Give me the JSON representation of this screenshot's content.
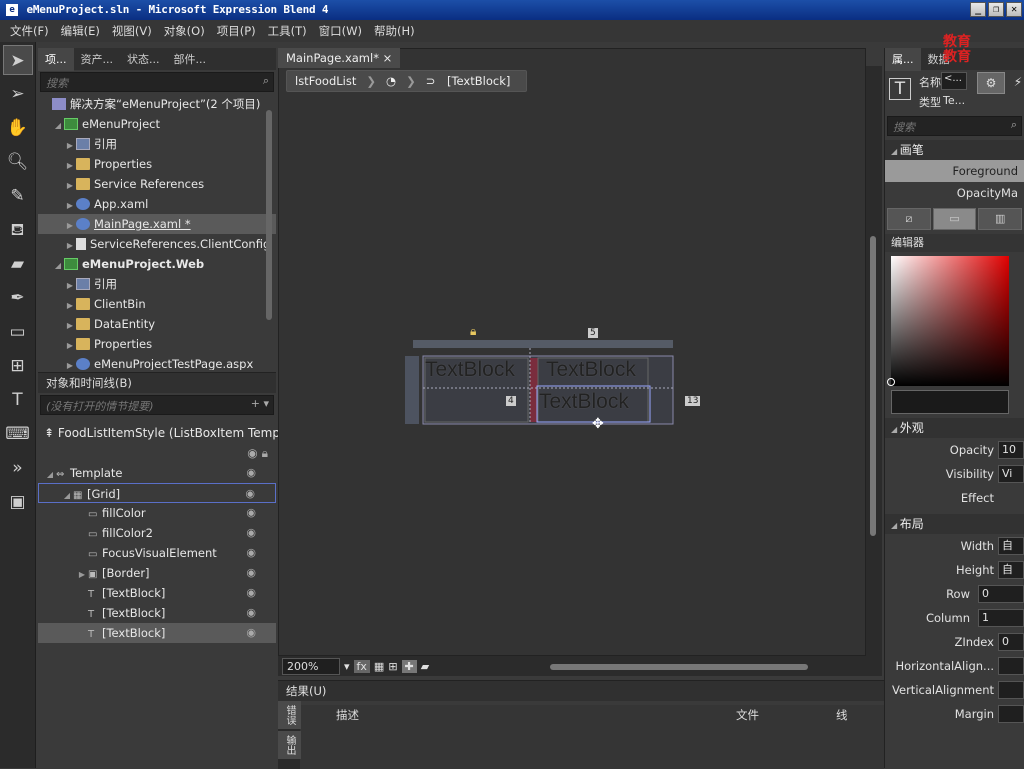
{
  "window": {
    "title": "eMenuProject.sln - Microsoft Expression Blend 4",
    "icon_name": "blend-app-icon"
  },
  "menu": [
    "文件(F)",
    "编辑(E)",
    "视图(V)",
    "对象(O)",
    "项目(P)",
    "工具(T)",
    "窗口(W)",
    "帮助(H)"
  ],
  "toolbox": [
    "selection-icon",
    "direct-selection-icon",
    "pan-icon",
    "zoom-icon",
    "eyedropper-icon",
    "paint-bucket-icon",
    "gradient-icon",
    "pen-icon",
    "rectangle-icon",
    "grid-layout-icon",
    "text-icon",
    "assets-icon",
    "expand-icon",
    "image-icon"
  ],
  "left_tabs": [
    "项...",
    "资产...",
    "状态...",
    "部件..."
  ],
  "project_search_placeholder": "搜索",
  "project_tree": [
    {
      "label": "解决方案“eMenuProject”(2 个项目)",
      "indent": 0,
      "icon": "sol"
    },
    {
      "label": "eMenuProject",
      "indent": 1,
      "icon": "proj",
      "bold": false
    },
    {
      "label": "引用",
      "indent": 2,
      "icon": "ref"
    },
    {
      "label": "Properties",
      "indent": 2,
      "icon": "folder"
    },
    {
      "label": "Service References",
      "indent": 2,
      "icon": "folder"
    },
    {
      "label": "App.xaml",
      "indent": 2,
      "icon": "file"
    },
    {
      "label": "MainPage.xaml *",
      "indent": 2,
      "icon": "file",
      "selected": true
    },
    {
      "label": "ServiceReferences.ClientConfig",
      "indent": 2,
      "icon": "doc"
    },
    {
      "label": "eMenuProject.Web",
      "indent": 1,
      "icon": "proj",
      "bold": true
    },
    {
      "label": "引用",
      "indent": 2,
      "icon": "ref"
    },
    {
      "label": "ClientBin",
      "indent": 2,
      "icon": "folder"
    },
    {
      "label": "DataEntity",
      "indent": 2,
      "icon": "folder"
    },
    {
      "label": "Properties",
      "indent": 2,
      "icon": "folder"
    },
    {
      "label": "eMenuProjectTestPage.aspx",
      "indent": 2,
      "icon": "file"
    }
  ],
  "objects": {
    "header": "对象和时间线(B)",
    "search_placeholder": "(没有打开的情节提要)",
    "scope": "FoodListItemStyle (ListBoxItem Templat...",
    "tree": [
      {
        "label": "Template",
        "indent": 0,
        "icon": "⇔"
      },
      {
        "label": "[Grid]",
        "indent": 1,
        "icon": "▦",
        "selected": true
      },
      {
        "label": "fillColor",
        "indent": 2,
        "icon": "▭"
      },
      {
        "label": "fillColor2",
        "indent": 2,
        "icon": "▭"
      },
      {
        "label": "FocusVisualElement",
        "indent": 2,
        "icon": "▭"
      },
      {
        "label": "[Border]",
        "indent": 2,
        "icon": "▣"
      },
      {
        "label": "[TextBlock]",
        "indent": 2,
        "icon": "T"
      },
      {
        "label": "[TextBlock]",
        "indent": 2,
        "icon": "T"
      },
      {
        "label": "[TextBlock]",
        "indent": 2,
        "icon": "T",
        "active": true
      }
    ]
  },
  "doc_tab": "MainPage.xaml*",
  "breadcrumb": [
    "lstFoodList",
    "[TextBlock]"
  ],
  "canvas": {
    "texts": [
      "TextBlock",
      "TextBlock",
      "TextBlock"
    ],
    "margin_left": "4",
    "margin_right": "13",
    "top_label": "5"
  },
  "status": {
    "zoom": "200%"
  },
  "results": {
    "header": "结果(U)",
    "cols": [
      "描述",
      "文件",
      "线"
    ],
    "side_tabs": [
      "错误",
      "输出"
    ]
  },
  "properties": {
    "tabs": [
      "属...",
      "数据"
    ],
    "name_label": "名称",
    "name_value": "<...",
    "type_label": "类型",
    "type_value": "Te...",
    "search_placeholder": "搜索",
    "brush_section": "画笔",
    "brush_list": [
      "Foreground",
      "OpacityMa"
    ],
    "editor_label": "编辑器",
    "appearance_section": "外观",
    "appearance": [
      {
        "label": "Opacity",
        "value": "10"
      },
      {
        "label": "Visibility",
        "value": "Vi"
      },
      {
        "label": "Effect",
        "value": ""
      }
    ],
    "layout_section": "布局",
    "layout": [
      {
        "label": "Width",
        "value": "自"
      },
      {
        "label": "Height",
        "value": "自"
      },
      {
        "label": "Row",
        "value": "0"
      },
      {
        "label": "Column",
        "value": "1"
      },
      {
        "label": "ZIndex",
        "value": "0"
      },
      {
        "label": "HorizontalAlign...",
        "value": ""
      },
      {
        "label": "VerticalAlignment",
        "value": ""
      },
      {
        "label": "Margin",
        "value": ""
      }
    ]
  },
  "watermark": {
    "text": "教育\n教育"
  }
}
